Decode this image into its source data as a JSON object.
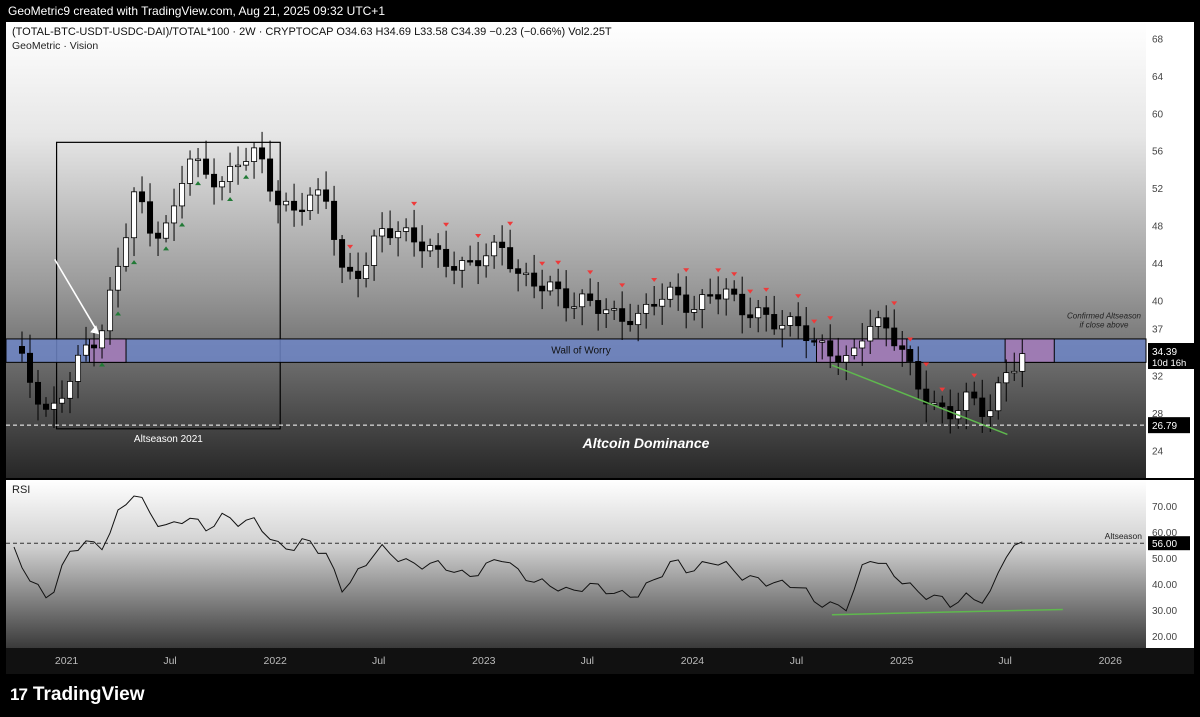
{
  "header": {
    "text": "GeoMetric9 created with TradingView.com, Aug 21, 2025 09:32 UTC+1"
  },
  "legend": {
    "symbol_line": "(TOTAL-BTC-USDT-USDC-DAI)/TOTAL*100 · 2W · CRYPTOCAP",
    "open": "O34.63",
    "high": "H34.69",
    "low": "L33.58",
    "close": "C34.39",
    "change": "−0.23 (−0.66%)",
    "volume": "Vol2.25T",
    "indicator": "GeoMetric · Vision"
  },
  "annotations": {
    "wall": "Wall of Worry",
    "altseason_2021": "Altseason 2021",
    "title": "Altcoin Dominance",
    "confirmed_1": "Confirmed Altseason",
    "confirmed_2": "if close above"
  },
  "price_labels": {
    "last": "34.39",
    "countdown": "10d 16h",
    "support": "26.79"
  },
  "rsi": {
    "label": "RSI",
    "level_name": "Altseason",
    "level_value": "56.00"
  },
  "footer": {
    "logo_mark": "17",
    "logo_text": "TradingView"
  },
  "colors": {
    "up": "#ffffff",
    "down": "#000000",
    "zone": "#6f86c7",
    "box": "#a37ab3",
    "trend": "#5fb84e",
    "bull_marker": "#217a36",
    "bear_marker": "#ee3a3a"
  },
  "chart_data": [
    {
      "type": "candlestick",
      "title": "Altcoin Dominance",
      "series_name": "(TOTAL-BTC-USDT-USDC-DAI)/TOTAL*100",
      "interval": "2W",
      "y_ticks": [
        24,
        28,
        32,
        37,
        40,
        44,
        48,
        52,
        56,
        60,
        64,
        68
      ],
      "x_ticks": [
        "2021",
        "Jul",
        "2022",
        "Jul",
        "2023",
        "Jul",
        "2024",
        "Jul",
        "2025",
        "Jul",
        "2026"
      ],
      "x_range": [
        "2020-10-01",
        "2026-03-01"
      ],
      "ylim": [
        22,
        69
      ],
      "close_path": [
        {
          "date": "2020-10-01",
          "v": 35.2
        },
        {
          "date": "2020-11-01",
          "v": 31.0
        },
        {
          "date": "2020-12-01",
          "v": 28.0
        },
        {
          "date": "2021-01-01",
          "v": 31.5
        },
        {
          "date": "2021-02-01",
          "v": 34.5
        },
        {
          "date": "2021-03-01",
          "v": 35.8
        },
        {
          "date": "2021-04-01",
          "v": 44.0
        },
        {
          "date": "2021-05-01",
          "v": 52.5
        },
        {
          "date": "2021-06-01",
          "v": 47.0
        },
        {
          "date": "2021-07-01",
          "v": 47.5
        },
        {
          "date": "2021-08-01",
          "v": 55.5
        },
        {
          "date": "2021-09-01",
          "v": 54.0
        },
        {
          "date": "2021-10-01",
          "v": 53.0
        },
        {
          "date": "2021-11-01",
          "v": 55.0
        },
        {
          "date": "2021-12-01",
          "v": 55.5
        },
        {
          "date": "2022-01-01",
          "v": 51.0
        },
        {
          "date": "2022-02-01",
          "v": 50.0
        },
        {
          "date": "2022-03-01",
          "v": 51.5
        },
        {
          "date": "2022-04-01",
          "v": 50.5
        },
        {
          "date": "2022-05-01",
          "v": 42.0
        },
        {
          "date": "2022-06-01",
          "v": 43.5
        },
        {
          "date": "2022-07-01",
          "v": 48.0
        },
        {
          "date": "2022-08-01",
          "v": 47.5
        },
        {
          "date": "2022-09-01",
          "v": 46.0
        },
        {
          "date": "2022-10-01",
          "v": 45.5
        },
        {
          "date": "2022-11-01",
          "v": 44.5
        },
        {
          "date": "2022-12-01",
          "v": 44.0
        },
        {
          "date": "2023-01-01",
          "v": 44.5
        },
        {
          "date": "2023-02-01",
          "v": 45.5
        },
        {
          "date": "2023-03-01",
          "v": 43.0
        },
        {
          "date": "2023-04-01",
          "v": 42.5
        },
        {
          "date": "2023-05-01",
          "v": 41.5
        },
        {
          "date": "2023-06-01",
          "v": 39.0
        },
        {
          "date": "2023-07-01",
          "v": 40.0
        },
        {
          "date": "2023-08-01",
          "v": 39.5
        },
        {
          "date": "2023-09-01",
          "v": 38.5
        },
        {
          "date": "2023-10-01",
          "v": 38.0
        },
        {
          "date": "2023-11-01",
          "v": 40.0
        },
        {
          "date": "2023-12-01",
          "v": 41.0
        },
        {
          "date": "2024-01-01",
          "v": 39.5
        },
        {
          "date": "2024-02-01",
          "v": 41.0
        },
        {
          "date": "2024-03-01",
          "v": 40.5
        },
        {
          "date": "2024-04-01",
          "v": 38.5
        },
        {
          "date": "2024-05-01",
          "v": 39.0
        },
        {
          "date": "2024-06-01",
          "v": 38.0
        },
        {
          "date": "2024-07-01",
          "v": 37.5
        },
        {
          "date": "2024-08-01",
          "v": 35.0
        },
        {
          "date": "2024-09-01",
          "v": 34.5
        },
        {
          "date": "2024-10-01",
          "v": 34.0
        },
        {
          "date": "2024-11-01",
          "v": 37.8
        },
        {
          "date": "2024-12-01",
          "v": 37.0
        },
        {
          "date": "2025-01-01",
          "v": 34.5
        },
        {
          "date": "2025-02-01",
          "v": 31.0
        },
        {
          "date": "2025-03-01",
          "v": 29.0
        },
        {
          "date": "2025-04-01",
          "v": 28.0
        },
        {
          "date": "2025-05-01",
          "v": 29.5
        },
        {
          "date": "2025-06-01",
          "v": 27.5
        },
        {
          "date": "2025-07-01",
          "v": 33.0
        },
        {
          "date": "2025-08-01",
          "v": 34.39
        }
      ],
      "zones": [
        {
          "name": "Wall of Worry",
          "y0": 33.5,
          "y1": 36.0
        }
      ],
      "support_level": 26.79
    },
    {
      "type": "line",
      "title": "RSI",
      "y_ticks": [
        20.0,
        30.0,
        40.0,
        50.0,
        60.0,
        70.0
      ],
      "ylim": [
        18,
        78
      ],
      "level": {
        "name": "Altseason",
        "value": 56.0
      },
      "points": [
        {
          "date": "2020-10-01",
          "v": 52
        },
        {
          "date": "2020-11-01",
          "v": 42
        },
        {
          "date": "2020-12-01",
          "v": 35
        },
        {
          "date": "2021-01-01",
          "v": 50
        },
        {
          "date": "2021-02-01",
          "v": 56
        },
        {
          "date": "2021-03-01",
          "v": 54
        },
        {
          "date": "2021-04-01",
          "v": 68
        },
        {
          "date": "2021-05-01",
          "v": 76
        },
        {
          "date": "2021-06-01",
          "v": 64
        },
        {
          "date": "2021-07-01",
          "v": 62
        },
        {
          "date": "2021-08-01",
          "v": 68
        },
        {
          "date": "2021-09-01",
          "v": 61
        },
        {
          "date": "2021-10-01",
          "v": 65
        },
        {
          "date": "2021-11-01",
          "v": 64
        },
        {
          "date": "2021-12-01",
          "v": 66
        },
        {
          "date": "2022-01-01",
          "v": 55
        },
        {
          "date": "2022-02-01",
          "v": 53
        },
        {
          "date": "2022-03-01",
          "v": 57
        },
        {
          "date": "2022-04-01",
          "v": 52
        },
        {
          "date": "2022-05-01",
          "v": 38
        },
        {
          "date": "2022-06-01",
          "v": 45
        },
        {
          "date": "2022-07-01",
          "v": 54
        },
        {
          "date": "2022-08-01",
          "v": 52
        },
        {
          "date": "2022-09-01",
          "v": 48
        },
        {
          "date": "2022-10-01",
          "v": 47
        },
        {
          "date": "2022-11-01",
          "v": 46
        },
        {
          "date": "2022-12-01",
          "v": 44
        },
        {
          "date": "2023-01-01",
          "v": 47
        },
        {
          "date": "2023-02-01",
          "v": 50
        },
        {
          "date": "2023-03-01",
          "v": 44
        },
        {
          "date": "2023-04-01",
          "v": 42
        },
        {
          "date": "2023-05-01",
          "v": 41
        },
        {
          "date": "2023-06-01",
          "v": 36
        },
        {
          "date": "2023-07-01",
          "v": 39
        },
        {
          "date": "2023-08-01",
          "v": 39
        },
        {
          "date": "2023-09-01",
          "v": 37
        },
        {
          "date": "2023-10-01",
          "v": 36
        },
        {
          "date": "2023-11-01",
          "v": 42
        },
        {
          "date": "2023-12-01",
          "v": 50
        },
        {
          "date": "2024-01-01",
          "v": 46
        },
        {
          "date": "2024-02-01",
          "v": 49
        },
        {
          "date": "2024-03-01",
          "v": 46
        },
        {
          "date": "2024-04-01",
          "v": 43
        },
        {
          "date": "2024-05-01",
          "v": 43
        },
        {
          "date": "2024-06-01",
          "v": 40
        },
        {
          "date": "2024-07-01",
          "v": 39
        },
        {
          "date": "2024-08-01",
          "v": 34
        },
        {
          "date": "2024-09-01",
          "v": 33
        },
        {
          "date": "2024-10-01",
          "v": 32
        },
        {
          "date": "2024-11-01",
          "v": 50
        },
        {
          "date": "2024-12-01",
          "v": 47
        },
        {
          "date": "2025-01-01",
          "v": 43
        },
        {
          "date": "2025-02-01",
          "v": 37
        },
        {
          "date": "2025-03-01",
          "v": 34
        },
        {
          "date": "2025-04-01",
          "v": 32
        },
        {
          "date": "2025-05-01",
          "v": 37
        },
        {
          "date": "2025-06-01",
          "v": 34
        },
        {
          "date": "2025-07-01",
          "v": 51
        },
        {
          "date": "2025-08-01",
          "v": 55
        }
      ]
    }
  ]
}
